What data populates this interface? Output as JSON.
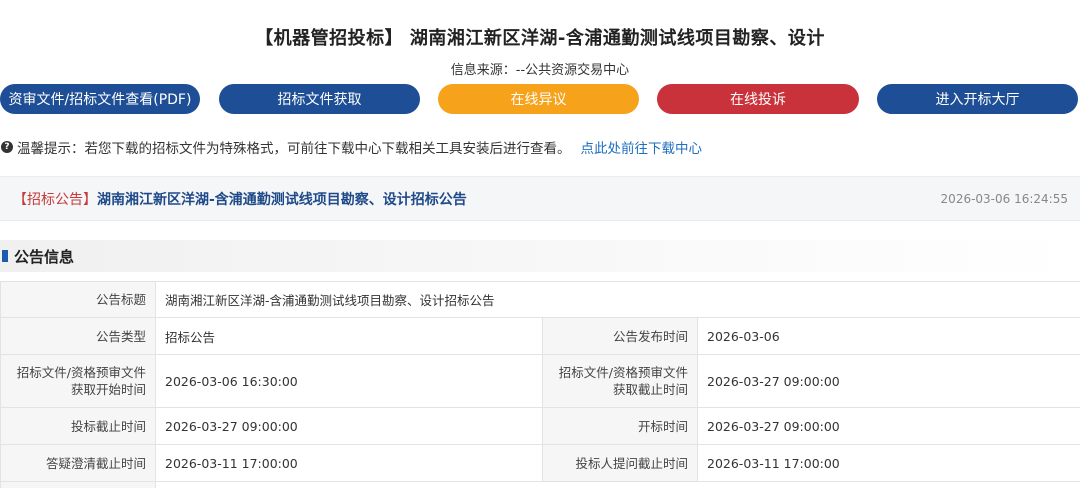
{
  "header": {
    "title": "【机器管招投标】 湖南湘江新区洋湖-含浦通勤测试线项目勘察、设计",
    "source": "信息来源：--公共资源交易中心"
  },
  "buttons": {
    "prequal_view": "资审文件/招标文件查看(PDF)",
    "get_docs": "招标文件获取",
    "objection": "在线异议",
    "complaint": "在线投诉",
    "bid_hall": "进入开标大厅"
  },
  "colors": {
    "navy": "#1d4e96",
    "orange": "#f7a21b",
    "red": "#c9323a",
    "tag_red": "#c53a3a",
    "title_blue": "#1f4a8a"
  },
  "notice": {
    "icon": "question-circle-icon",
    "text": "温馨提示：若您下载的招标文件为特殊格式，可前往下载中心下载相关工具安装后进行查看。",
    "link": "点此处前往下载中心"
  },
  "announcement": {
    "tag": "【招标公告】",
    "title": "湖南湘江新区洋湖-含浦通勤测试线项目勘察、设计招标公告",
    "time": "2026-03-06 16:24:55"
  },
  "section": {
    "title": "公告信息"
  },
  "info": {
    "row1": {
      "label": "公告标题",
      "value": "湖南湘江新区洋湖-含浦通勤测试线项目勘察、设计招标公告"
    },
    "row2": {
      "label1": "公告类型",
      "value1": "招标公告",
      "label2": "公告发布时间",
      "value2": "2026-03-06"
    },
    "row3": {
      "label1a": "招标文件/资格预审文件",
      "label1b": "获取开始时间",
      "value1": "2026-03-06 16:30:00",
      "label2a": "招标文件/资格预审文件",
      "label2b": "获取截止时间",
      "value2": "2026-03-27 09:00:00"
    },
    "row4": {
      "label1": "投标截止时间",
      "value1": "2026-03-27 09:00:00",
      "label2": "开标时间",
      "value2": "2026-03-27 09:00:00"
    },
    "row5": {
      "label1": "答疑澄清截止时间",
      "value1": "2026-03-11 17:00:00",
      "label2": "投标人提问截止时间",
      "value2": "2026-03-11 17:00:00"
    }
  }
}
